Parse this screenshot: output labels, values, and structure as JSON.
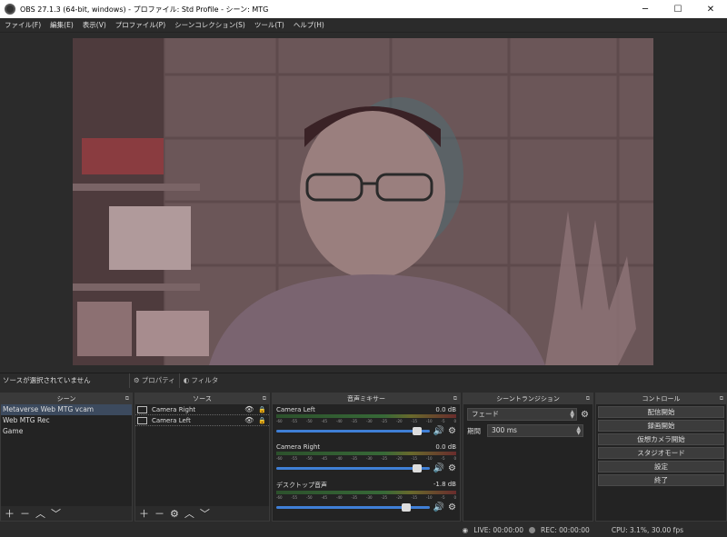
{
  "window": {
    "title": "OBS 27.1.3 (64-bit, windows) - プロファイル: Std Profile - シーン: MTG",
    "minimize": "─",
    "maximize": "☐",
    "close": "✕"
  },
  "menu": [
    "ファイル(F)",
    "編集(E)",
    "表示(V)",
    "プロファイル(P)",
    "シーンコレクション(S)",
    "ツール(T)",
    "ヘルプ(H)"
  ],
  "source_bar": {
    "no_selection": "ソースが選択されていません",
    "properties": "プロパティ",
    "filters": "フィルタ"
  },
  "scenes": {
    "title": "シーン",
    "items": [
      "Metaverse Web MTG vcam",
      "Web MTG Rec",
      "Game"
    ],
    "selected_index": 0
  },
  "sources": {
    "title": "ソース",
    "items": [
      "Camera Right",
      "Camera Left"
    ]
  },
  "mixer": {
    "title": "音声ミキサー",
    "ticks": [
      "-60",
      "-55",
      "-50",
      "-45",
      "-40",
      "-35",
      "-30",
      "-25",
      "-20",
      "-15",
      "-10",
      "-5",
      "0"
    ],
    "channels": [
      {
        "name": "Camera Left",
        "db": "0.0 dB",
        "level": 0.95
      },
      {
        "name": "Camera Right",
        "db": "0.0 dB",
        "level": 0.95
      },
      {
        "name": "デスクトップ音声",
        "db": "-1.8 dB",
        "level": 0.88
      }
    ]
  },
  "transitions": {
    "title": "シーントランジション",
    "type": "フェード",
    "duration_label": "期間",
    "duration": "300 ms"
  },
  "controls": {
    "title": "コントロール",
    "buttons": [
      "配信開始",
      "録画開始",
      "仮想カメラ開始",
      "スタジオモード",
      "設定",
      "終了"
    ]
  },
  "status": {
    "live": "LIVE: 00:00:00",
    "rec": "REC: 00:00:00",
    "cpu": "CPU: 3.1%, 30.00 fps"
  },
  "colors": {
    "accent": "#3f7fd6",
    "panel_bg": "#232323",
    "selected": "#3c4a5e"
  }
}
